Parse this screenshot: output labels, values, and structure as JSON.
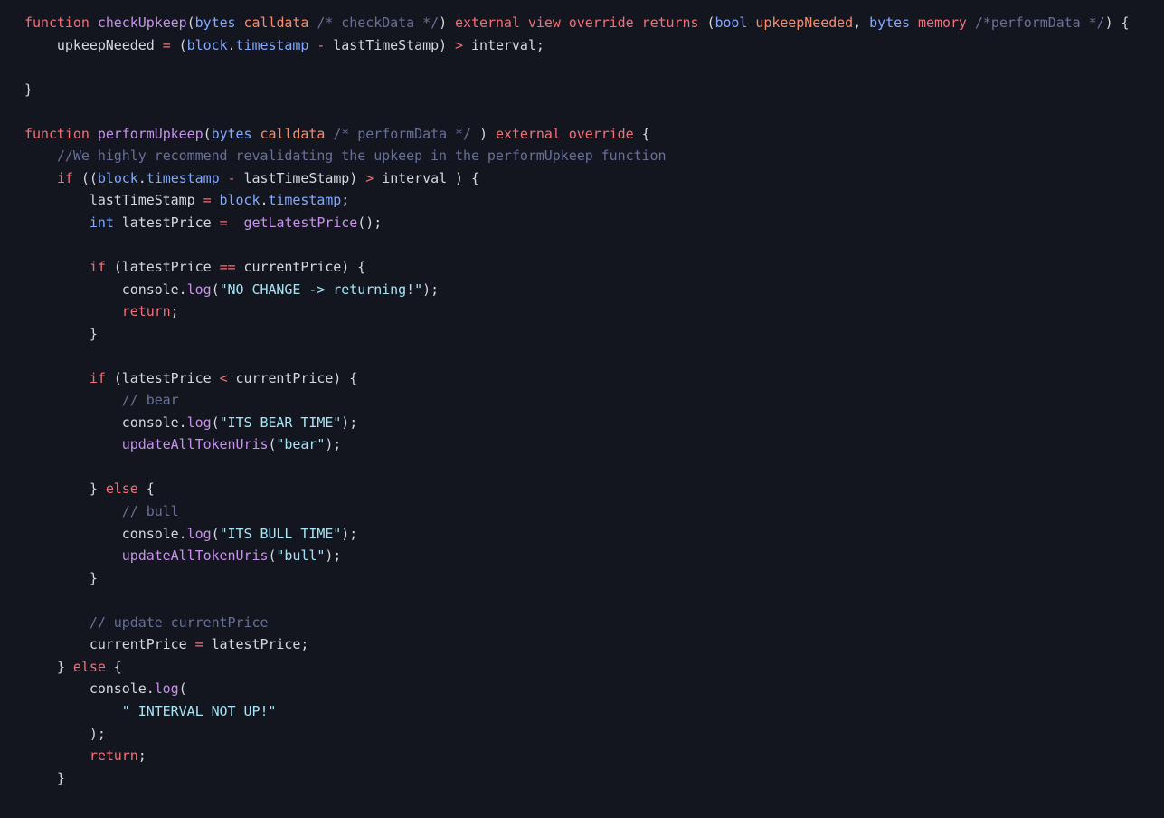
{
  "editor": {
    "language": "solidity",
    "background_color": "#13151f",
    "font_size_px": 15,
    "line_height_px": 24.55,
    "theme_colors": {
      "plain": "#d5d8e0",
      "keyword": "#f07178",
      "function": "#c792ea",
      "type": "#82aaff",
      "parameter": "#f78c6c",
      "string": "#a5e5f5",
      "comment": "#697098",
      "operator": "#f07178",
      "punctuation": "#d5d8e0",
      "property": "#82aaff"
    }
  },
  "code": {
    "lines": [
      {
        "text": "function checkUpkeep(bytes calldata /* checkData */) external view override returns (bool upkeepNeeded, bytes memory /*performData */) {",
        "tokens": [
          {
            "t": "function",
            "c": "kw"
          },
          {
            "t": " ",
            "c": "plain"
          },
          {
            "t": "checkUpkeep",
            "c": "fn"
          },
          {
            "t": "(",
            "c": "punct"
          },
          {
            "t": "bytes",
            "c": "type"
          },
          {
            "t": " ",
            "c": "plain"
          },
          {
            "t": "calldata",
            "c": "param"
          },
          {
            "t": " ",
            "c": "plain"
          },
          {
            "t": "/* checkData */",
            "c": "comment"
          },
          {
            "t": ")",
            "c": "punct"
          },
          {
            "t": " ",
            "c": "plain"
          },
          {
            "t": "external view override returns",
            "c": "kw"
          },
          {
            "t": " ",
            "c": "plain"
          },
          {
            "t": "(",
            "c": "punct"
          },
          {
            "t": "bool",
            "c": "type"
          },
          {
            "t": " ",
            "c": "plain"
          },
          {
            "t": "upkeepNeeded",
            "c": "param"
          },
          {
            "t": ", ",
            "c": "punct"
          },
          {
            "t": "bytes",
            "c": "type"
          },
          {
            "t": " ",
            "c": "plain"
          },
          {
            "t": "memory",
            "c": "kw"
          },
          {
            "t": " ",
            "c": "plain"
          },
          {
            "t": "/*performData */",
            "c": "comment"
          },
          {
            "t": ") {",
            "c": "punct"
          }
        ]
      },
      {
        "text": "    upkeepNeeded = (block.timestamp - lastTimeStamp) > interval;",
        "tokens": [
          {
            "t": "    upkeepNeeded ",
            "c": "plain"
          },
          {
            "t": "=",
            "c": "op"
          },
          {
            "t": " (",
            "c": "punct"
          },
          {
            "t": "block",
            "c": "type"
          },
          {
            "t": ".",
            "c": "punct"
          },
          {
            "t": "timestamp",
            "c": "prop"
          },
          {
            "t": " ",
            "c": "plain"
          },
          {
            "t": "-",
            "c": "op"
          },
          {
            "t": " lastTimeStamp) ",
            "c": "plain"
          },
          {
            "t": ">",
            "c": "op"
          },
          {
            "t": " interval;",
            "c": "plain"
          }
        ]
      },
      {
        "text": "",
        "tokens": []
      },
      {
        "text": "}",
        "tokens": [
          {
            "t": "}",
            "c": "punct"
          }
        ]
      },
      {
        "text": "",
        "tokens": []
      },
      {
        "text": "function performUpkeep(bytes calldata /* performData */ ) external override {",
        "tokens": [
          {
            "t": "function",
            "c": "kw"
          },
          {
            "t": " ",
            "c": "plain"
          },
          {
            "t": "performUpkeep",
            "c": "fn"
          },
          {
            "t": "(",
            "c": "punct"
          },
          {
            "t": "bytes",
            "c": "type"
          },
          {
            "t": " ",
            "c": "plain"
          },
          {
            "t": "calldata",
            "c": "param"
          },
          {
            "t": " ",
            "c": "plain"
          },
          {
            "t": "/* performData */",
            "c": "comment"
          },
          {
            "t": " ) ",
            "c": "punct"
          },
          {
            "t": "external override",
            "c": "kw"
          },
          {
            "t": " {",
            "c": "punct"
          }
        ]
      },
      {
        "text": "    //We highly recommend revalidating the upkeep in the performUpkeep function",
        "tokens": [
          {
            "t": "    ",
            "c": "plain"
          },
          {
            "t": "//We highly recommend revalidating the upkeep in the performUpkeep function",
            "c": "comment"
          }
        ]
      },
      {
        "text": "    if ((block.timestamp - lastTimeStamp) > interval ) {",
        "tokens": [
          {
            "t": "    ",
            "c": "plain"
          },
          {
            "t": "if",
            "c": "kw"
          },
          {
            "t": " ((",
            "c": "punct"
          },
          {
            "t": "block",
            "c": "type"
          },
          {
            "t": ".",
            "c": "punct"
          },
          {
            "t": "timestamp",
            "c": "prop"
          },
          {
            "t": " ",
            "c": "plain"
          },
          {
            "t": "-",
            "c": "op"
          },
          {
            "t": " lastTimeStamp) ",
            "c": "plain"
          },
          {
            "t": ">",
            "c": "op"
          },
          {
            "t": " interval ) {",
            "c": "plain"
          }
        ]
      },
      {
        "text": "        lastTimeStamp = block.timestamp;",
        "tokens": [
          {
            "t": "        lastTimeStamp ",
            "c": "plain"
          },
          {
            "t": "=",
            "c": "op"
          },
          {
            "t": " ",
            "c": "plain"
          },
          {
            "t": "block",
            "c": "type"
          },
          {
            "t": ".",
            "c": "punct"
          },
          {
            "t": "timestamp",
            "c": "prop"
          },
          {
            "t": ";",
            "c": "punct"
          }
        ]
      },
      {
        "text": "        int latestPrice =  getLatestPrice();",
        "tokens": [
          {
            "t": "        ",
            "c": "plain"
          },
          {
            "t": "int",
            "c": "type"
          },
          {
            "t": " latestPrice ",
            "c": "plain"
          },
          {
            "t": "=",
            "c": "op"
          },
          {
            "t": "  ",
            "c": "plain"
          },
          {
            "t": "getLatestPrice",
            "c": "fn"
          },
          {
            "t": "();",
            "c": "punct"
          }
        ]
      },
      {
        "text": "",
        "tokens": []
      },
      {
        "text": "        if (latestPrice == currentPrice) {",
        "tokens": [
          {
            "t": "        ",
            "c": "plain"
          },
          {
            "t": "if",
            "c": "kw"
          },
          {
            "t": " (latestPrice ",
            "c": "plain"
          },
          {
            "t": "==",
            "c": "op"
          },
          {
            "t": " currentPrice) {",
            "c": "plain"
          }
        ]
      },
      {
        "text": "            console.log(\"NO CHANGE -> returning!\");",
        "tokens": [
          {
            "t": "            console",
            "c": "plain"
          },
          {
            "t": ".",
            "c": "punct"
          },
          {
            "t": "log",
            "c": "fn"
          },
          {
            "t": "(",
            "c": "punct"
          },
          {
            "t": "\"NO CHANGE -> returning!\"",
            "c": "str"
          },
          {
            "t": ");",
            "c": "punct"
          }
        ]
      },
      {
        "text": "            return;",
        "tokens": [
          {
            "t": "            ",
            "c": "plain"
          },
          {
            "t": "return",
            "c": "kw"
          },
          {
            "t": ";",
            "c": "punct"
          }
        ]
      },
      {
        "text": "        }",
        "tokens": [
          {
            "t": "        }",
            "c": "punct"
          }
        ]
      },
      {
        "text": "",
        "tokens": []
      },
      {
        "text": "        if (latestPrice < currentPrice) {",
        "tokens": [
          {
            "t": "        ",
            "c": "plain"
          },
          {
            "t": "if",
            "c": "kw"
          },
          {
            "t": " (latestPrice ",
            "c": "plain"
          },
          {
            "t": "<",
            "c": "op"
          },
          {
            "t": " currentPrice) {",
            "c": "plain"
          }
        ]
      },
      {
        "text": "            // bear",
        "tokens": [
          {
            "t": "            ",
            "c": "plain"
          },
          {
            "t": "// bear",
            "c": "comment"
          }
        ]
      },
      {
        "text": "            console.log(\"ITS BEAR TIME\");",
        "tokens": [
          {
            "t": "            console",
            "c": "plain"
          },
          {
            "t": ".",
            "c": "punct"
          },
          {
            "t": "log",
            "c": "fn"
          },
          {
            "t": "(",
            "c": "punct"
          },
          {
            "t": "\"ITS BEAR TIME\"",
            "c": "str"
          },
          {
            "t": ");",
            "c": "punct"
          }
        ]
      },
      {
        "text": "            updateAllTokenUris(\"bear\");",
        "tokens": [
          {
            "t": "            ",
            "c": "plain"
          },
          {
            "t": "updateAllTokenUris",
            "c": "fn"
          },
          {
            "t": "(",
            "c": "punct"
          },
          {
            "t": "\"bear\"",
            "c": "str"
          },
          {
            "t": ");",
            "c": "punct"
          }
        ]
      },
      {
        "text": "",
        "tokens": []
      },
      {
        "text": "        } else {",
        "tokens": [
          {
            "t": "        } ",
            "c": "punct"
          },
          {
            "t": "else",
            "c": "kw"
          },
          {
            "t": " {",
            "c": "punct"
          }
        ]
      },
      {
        "text": "            // bull",
        "tokens": [
          {
            "t": "            ",
            "c": "plain"
          },
          {
            "t": "// bull",
            "c": "comment"
          }
        ]
      },
      {
        "text": "            console.log(\"ITS BULL TIME\");",
        "tokens": [
          {
            "t": "            console",
            "c": "plain"
          },
          {
            "t": ".",
            "c": "punct"
          },
          {
            "t": "log",
            "c": "fn"
          },
          {
            "t": "(",
            "c": "punct"
          },
          {
            "t": "\"ITS BULL TIME\"",
            "c": "str"
          },
          {
            "t": ");",
            "c": "punct"
          }
        ]
      },
      {
        "text": "            updateAllTokenUris(\"bull\");",
        "tokens": [
          {
            "t": "            ",
            "c": "plain"
          },
          {
            "t": "updateAllTokenUris",
            "c": "fn"
          },
          {
            "t": "(",
            "c": "punct"
          },
          {
            "t": "\"bull\"",
            "c": "str"
          },
          {
            "t": ");",
            "c": "punct"
          }
        ]
      },
      {
        "text": "        }",
        "tokens": [
          {
            "t": "        }",
            "c": "punct"
          }
        ]
      },
      {
        "text": "",
        "tokens": []
      },
      {
        "text": "        // update currentPrice",
        "tokens": [
          {
            "t": "        ",
            "c": "plain"
          },
          {
            "t": "// update currentPrice",
            "c": "comment"
          }
        ]
      },
      {
        "text": "        currentPrice = latestPrice;",
        "tokens": [
          {
            "t": "        currentPrice ",
            "c": "plain"
          },
          {
            "t": "=",
            "c": "op"
          },
          {
            "t": " latestPrice;",
            "c": "plain"
          }
        ]
      },
      {
        "text": "    } else {",
        "tokens": [
          {
            "t": "    } ",
            "c": "punct"
          },
          {
            "t": "else",
            "c": "kw"
          },
          {
            "t": " {",
            "c": "punct"
          }
        ]
      },
      {
        "text": "        console.log(",
        "tokens": [
          {
            "t": "        console",
            "c": "plain"
          },
          {
            "t": ".",
            "c": "punct"
          },
          {
            "t": "log",
            "c": "fn"
          },
          {
            "t": "(",
            "c": "punct"
          }
        ]
      },
      {
        "text": "            \" INTERVAL NOT UP!\"",
        "tokens": [
          {
            "t": "            ",
            "c": "plain"
          },
          {
            "t": "\" INTERVAL NOT UP!\"",
            "c": "str"
          }
        ]
      },
      {
        "text": "        );",
        "tokens": [
          {
            "t": "        );",
            "c": "punct"
          }
        ]
      },
      {
        "text": "        return;",
        "tokens": [
          {
            "t": "        ",
            "c": "plain"
          },
          {
            "t": "return",
            "c": "kw"
          },
          {
            "t": ";",
            "c": "punct"
          }
        ]
      },
      {
        "text": "    }",
        "tokens": [
          {
            "t": "    }",
            "c": "punct"
          }
        ]
      }
    ]
  }
}
